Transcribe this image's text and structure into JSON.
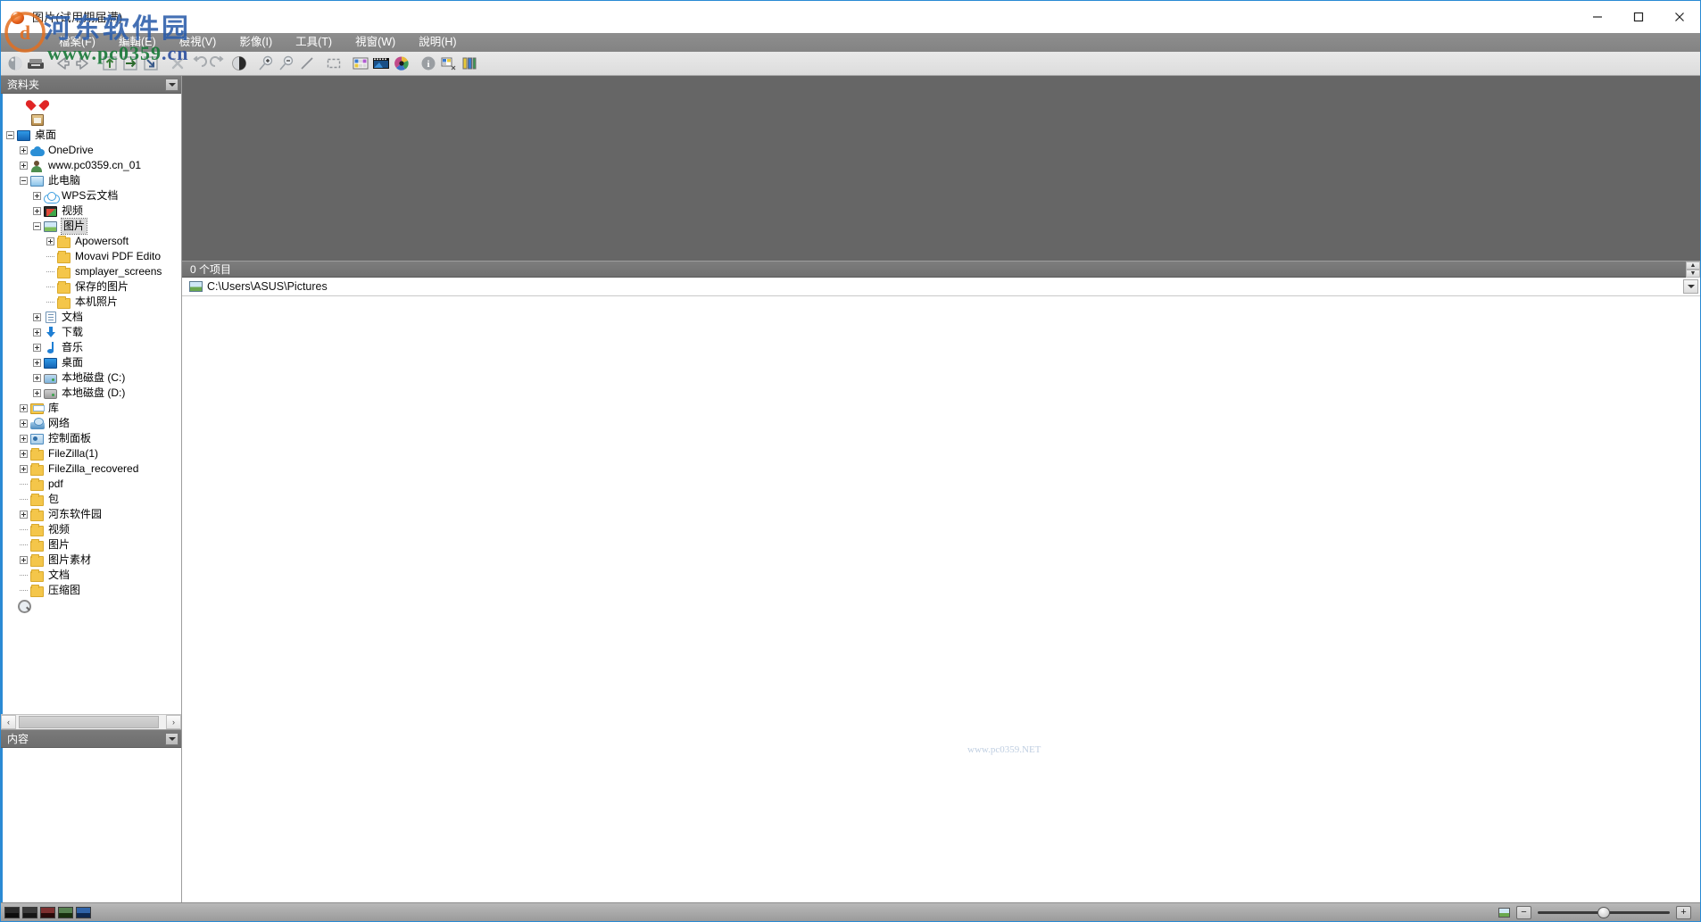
{
  "window": {
    "title": "图片(试用期届满)",
    "app_icon": "picture-app-icon",
    "controls": {
      "minimize": "—",
      "maximize": "□",
      "close": "✕"
    }
  },
  "menubar": {
    "items": [
      {
        "name": "file",
        "label": "檔案(F)",
        "text": "檔案",
        "accel": "F"
      },
      {
        "name": "edit",
        "label": "編輯(E)",
        "text": "編輯",
        "accel": "E"
      },
      {
        "name": "view",
        "label": "檢視(V)",
        "text": "檢視",
        "accel": "V"
      },
      {
        "name": "image",
        "label": "影像(I)",
        "text": "影像",
        "accel": "I"
      },
      {
        "name": "tools",
        "label": "工具(T)",
        "text": "工具",
        "accel": "T"
      },
      {
        "name": "window",
        "label": "視窗(W)",
        "text": "視窗",
        "accel": "W"
      },
      {
        "name": "help",
        "label": "說明(H)",
        "text": "說明",
        "accel": "H"
      }
    ]
  },
  "toolbar": {
    "buttons": [
      {
        "name": "browser-icon",
        "glyph": "sphere"
      },
      {
        "name": "scanner-icon",
        "glyph": "scanner"
      },
      {
        "name": "previous-image-icon",
        "glyph": "arrow-left"
      },
      {
        "name": "next-image-icon",
        "glyph": "arrow-right"
      },
      {
        "name": "move-up-icon",
        "glyph": "arrow-up-box"
      },
      {
        "name": "move-right-icon",
        "glyph": "arrow-right-box"
      },
      {
        "name": "move-down-icon",
        "glyph": "arrow-down-box"
      },
      {
        "name": "delete-icon",
        "glyph": "cross"
      },
      {
        "name": "rotate-left-icon",
        "glyph": "undo"
      },
      {
        "name": "rotate-right-icon",
        "glyph": "redo"
      },
      {
        "name": "contrast-icon",
        "glyph": "half-circle"
      },
      {
        "name": "zoom-in-icon",
        "glyph": "magnifier-plus"
      },
      {
        "name": "zoom-out-icon",
        "glyph": "magnifier-minus"
      },
      {
        "name": "actual-size-icon",
        "glyph": "diagonal-line"
      },
      {
        "name": "crop-icon",
        "glyph": "dashed-rect"
      },
      {
        "name": "thumbnails-icon",
        "glyph": "color-tiles"
      },
      {
        "name": "filmstrip-icon",
        "glyph": "filmstrip"
      },
      {
        "name": "settings-icon",
        "glyph": "color-wheel"
      },
      {
        "name": "info-icon",
        "glyph": "info-circle"
      },
      {
        "name": "batch-icon",
        "glyph": "batch-tiles"
      },
      {
        "name": "columns-icon",
        "glyph": "columns"
      }
    ]
  },
  "watermark": {
    "chinese": "河东软件园",
    "url_user": "www.pc0359",
    "url_domain": ".cn",
    "center": "www.pc0359.NET"
  },
  "left_pane": {
    "folders_header": {
      "label": "资料夹",
      "dropdown": "chevron-down-icon"
    },
    "content_header": {
      "label": "内容",
      "dropdown": "chevron-down-icon"
    },
    "hscroll": {
      "left": "‹",
      "right": "›"
    },
    "tree": [
      {
        "label": "",
        "icon": "heart",
        "indent": 1,
        "expander": "none",
        "selected": false
      },
      {
        "label": "",
        "icon": "clipboard",
        "indent": 1,
        "expander": "none",
        "selected": false
      },
      {
        "label": "桌面",
        "icon": "monitor",
        "indent": 0,
        "expander": "minus",
        "selected": false
      },
      {
        "label": "OneDrive",
        "icon": "cloud",
        "indent": 1,
        "expander": "plus",
        "selected": false
      },
      {
        "label": "www.pc0359.cn_01",
        "icon": "user",
        "indent": 1,
        "expander": "plus",
        "selected": false
      },
      {
        "label": "此电脑",
        "icon": "pc",
        "indent": 1,
        "expander": "minus",
        "selected": false
      },
      {
        "label": "WPS云文档",
        "icon": "cloud-outline",
        "indent": 2,
        "expander": "plus",
        "selected": false
      },
      {
        "label": "视频",
        "icon": "video",
        "indent": 2,
        "expander": "plus",
        "selected": false
      },
      {
        "label": "图片",
        "icon": "picture",
        "indent": 2,
        "expander": "minus",
        "selected": true
      },
      {
        "label": "Apowersoft",
        "icon": "folder",
        "indent": 3,
        "expander": "plus",
        "selected": false
      },
      {
        "label": "Movavi PDF Edito",
        "icon": "folder",
        "indent": 3,
        "expander": "leaf",
        "selected": false
      },
      {
        "label": "smplayer_screens",
        "icon": "folder",
        "indent": 3,
        "expander": "leaf",
        "selected": false
      },
      {
        "label": "保存的图片",
        "icon": "folder",
        "indent": 3,
        "expander": "leaf",
        "selected": false
      },
      {
        "label": "本机照片",
        "icon": "folder",
        "indent": 3,
        "expander": "leaf",
        "selected": false
      },
      {
        "label": "文档",
        "icon": "doc",
        "indent": 2,
        "expander": "plus",
        "selected": false
      },
      {
        "label": "下载",
        "icon": "download",
        "indent": 2,
        "expander": "plus",
        "selected": false
      },
      {
        "label": "音乐",
        "icon": "music",
        "indent": 2,
        "expander": "plus",
        "selected": false
      },
      {
        "label": "桌面",
        "icon": "monitor",
        "indent": 2,
        "expander": "plus",
        "selected": false
      },
      {
        "label": "本地磁盘 (C:)",
        "icon": "disk-sys",
        "indent": 2,
        "expander": "plus",
        "selected": false
      },
      {
        "label": "本地磁盘 (D:)",
        "icon": "disk",
        "indent": 2,
        "expander": "plus",
        "selected": false
      },
      {
        "label": "库",
        "icon": "library",
        "indent": 1,
        "expander": "plus",
        "selected": false
      },
      {
        "label": "网络",
        "icon": "network",
        "indent": 1,
        "expander": "plus",
        "selected": false
      },
      {
        "label": "控制面板",
        "icon": "control",
        "indent": 1,
        "expander": "plus",
        "selected": false
      },
      {
        "label": "FileZilla(1)",
        "icon": "folder",
        "indent": 1,
        "expander": "plus",
        "selected": false
      },
      {
        "label": "FileZilla_recovered",
        "icon": "folder",
        "indent": 1,
        "expander": "plus",
        "selected": false
      },
      {
        "label": "pdf",
        "icon": "folder",
        "indent": 1,
        "expander": "leaf",
        "selected": false
      },
      {
        "label": "包",
        "icon": "folder",
        "indent": 1,
        "expander": "leaf",
        "selected": false
      },
      {
        "label": "河东软件园",
        "icon": "folder",
        "indent": 1,
        "expander": "plus",
        "selected": false
      },
      {
        "label": "视频",
        "icon": "folder",
        "indent": 1,
        "expander": "leaf",
        "selected": false
      },
      {
        "label": "图片",
        "icon": "folder",
        "indent": 1,
        "expander": "leaf",
        "selected": false
      },
      {
        "label": "图片素材",
        "icon": "folder",
        "indent": 1,
        "expander": "plus",
        "selected": false
      },
      {
        "label": "文档",
        "icon": "folder",
        "indent": 1,
        "expander": "leaf",
        "selected": false
      },
      {
        "label": "压缩图",
        "icon": "folder",
        "indent": 1,
        "expander": "leaf",
        "selected": false
      },
      {
        "label": "",
        "icon": "search",
        "indent": 0,
        "expander": "none",
        "selected": false
      }
    ]
  },
  "main": {
    "item_count_label": "0 个项目",
    "path": "C:\\Users\\ASUS\\Pictures",
    "path_icon": "picture-icon",
    "path_dropdown": "chevron-down-icon",
    "scroll_up": "▲",
    "scroll_down": "▼"
  },
  "statusbar": {
    "thumbnails": [
      {
        "name": "thumb-1",
        "top": "#2a2a2a",
        "bottom": "#0d0d0d"
      },
      {
        "name": "thumb-2",
        "top": "#3a3a3a",
        "bottom": "#161616"
      },
      {
        "name": "thumb-3",
        "top": "#7d2f2f",
        "bottom": "#2a0a0a"
      },
      {
        "name": "thumb-4",
        "top": "#55804f",
        "bottom": "#18300f"
      },
      {
        "name": "thumb-5",
        "top": "#2f63a8",
        "bottom": "#0d2850"
      }
    ],
    "zoom_out_label": "−",
    "zoom_in_label": "+",
    "zoom_value": 50
  },
  "colors": {
    "accent_border": "#2a8ad4",
    "menu_bg": "#8a8a8a",
    "preview_bg": "#666666",
    "pane_header_bg": "#757575"
  }
}
